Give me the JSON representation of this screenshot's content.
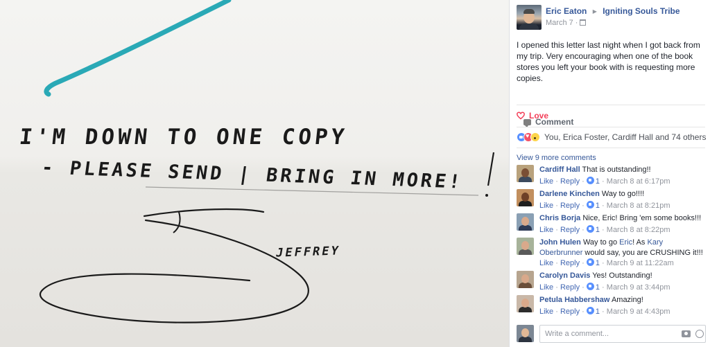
{
  "photo": {
    "handwriting_line1": "I'M DOWN TO ONE COPY",
    "handwriting_line2": "- PLEASE SEND | BRING IN MORE!",
    "signature": "JEFFREY"
  },
  "post": {
    "author": "Eric Eaton",
    "group": "Igniting Souls Tribe",
    "date": "March 7",
    "text": "I opened this letter last night when I got back from my trip. Very encouraging when one of the book stores you left your book with is requesting more copies."
  },
  "actions": {
    "love": "Love",
    "comment": "Comment"
  },
  "reactions": {
    "summary": "You, Erica Foster, Cardiff Hall and 74 others",
    "icons": [
      "like",
      "love",
      "wow"
    ]
  },
  "view_more": "View 9 more comments",
  "comments": [
    {
      "name": "Cardiff Hall",
      "text": "That is outstanding!!",
      "like": "Like",
      "reply": "Reply",
      "likes": "1",
      "time": "March 8 at 6:17pm"
    },
    {
      "name": "Darlene Kinchen",
      "text": "Way to go!!!!",
      "like": "Like",
      "reply": "Reply",
      "likes": "1",
      "time": "March 8 at 8:21pm"
    },
    {
      "name": "Chris Borja",
      "text": "Nice, Eric! Bring 'em some books!!!",
      "like": "Like",
      "reply": "Reply",
      "likes": "1",
      "time": "March 8 at 8:22pm"
    },
    {
      "name": "John Hulen",
      "text_a": "Way to go ",
      "mention1": "Eric",
      "text_b": "! As ",
      "mention2": "Kary Oberbrunner",
      "text_c": " would say, you are CRUSHING it!!!",
      "like": "Like",
      "reply": "Reply",
      "likes": "1",
      "time": "March 9 at 11:22am"
    },
    {
      "name": "Carolyn Davis",
      "text": "Yes! Outstanding!",
      "like": "Like",
      "reply": "Reply",
      "likes": "1",
      "time": "March 9 at 3:44pm"
    },
    {
      "name": "Petula Habbershaw",
      "text": "Amazing!",
      "like": "Like",
      "reply": "Reply",
      "likes": "1",
      "time": "March 9 at 4:43pm"
    }
  ],
  "composer": {
    "placeholder": "Write a comment..."
  },
  "colors": {
    "link": "#365899",
    "love": "#f33e58",
    "meta": "#90949c"
  }
}
